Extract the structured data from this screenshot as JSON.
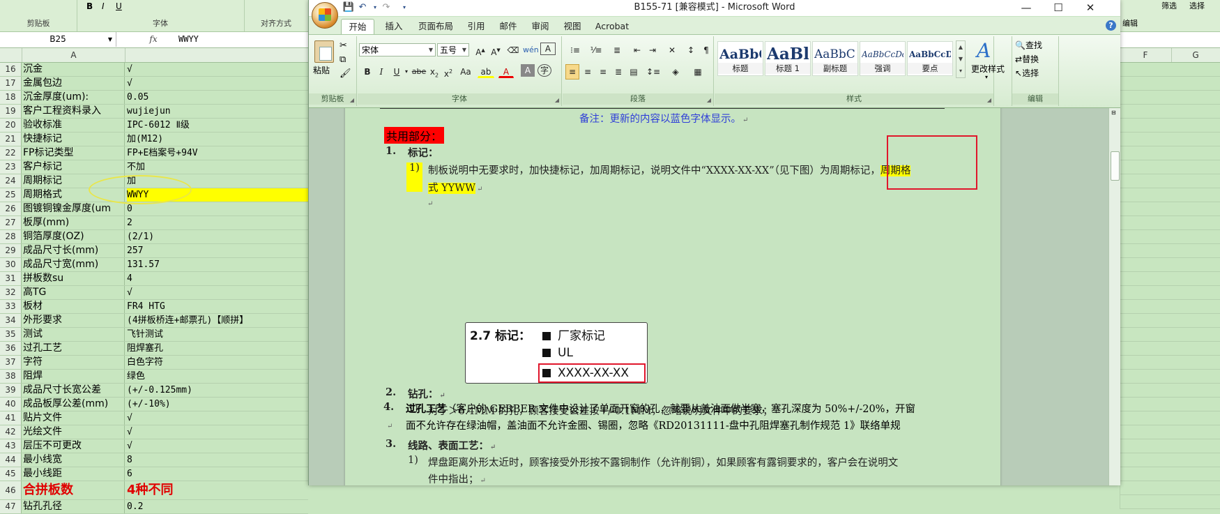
{
  "excel": {
    "ribbon_groups": [
      "剪贴板",
      "字体",
      "对齐方式",
      "编辑"
    ],
    "ribbon_right_buttons": [
      "筛选",
      "选择"
    ],
    "name_box": "B25",
    "fx": "fx",
    "formula_value": "WWYY",
    "columns": [
      "A",
      "F",
      "G"
    ],
    "rows": [
      {
        "n": "16",
        "a": "沉金",
        "b": "√"
      },
      {
        "n": "17",
        "a": "金属包边",
        "b": "√"
      },
      {
        "n": "18",
        "a": "沉金厚度(um):",
        "b": "0.05"
      },
      {
        "n": "19",
        "a": "客户工程资料录入",
        "b": "wujiejun"
      },
      {
        "n": "20",
        "a": "验收标准",
        "b": "IPC-6012 Ⅱ级"
      },
      {
        "n": "21",
        "a": "快捷标记",
        "b": "加(M12)"
      },
      {
        "n": "22",
        "a": "FP标记类型",
        "b": "FP+E档案号+94V"
      },
      {
        "n": "23",
        "a": "客户标记",
        "b": "不加"
      },
      {
        "n": "24",
        "a": "周期标记",
        "b": "加"
      },
      {
        "n": "25",
        "a": "周期格式",
        "b": "WWYY",
        "highlight": true
      },
      {
        "n": "26",
        "a": "图镀铜镍金厚度(um",
        "b": "0"
      },
      {
        "n": "27",
        "a": "板厚(mm)",
        "b": "2"
      },
      {
        "n": "28",
        "a": "铜箔厚度(OZ)",
        "b": "(2/1)"
      },
      {
        "n": "29",
        "a": "成品尺寸长(mm)",
        "b": "257"
      },
      {
        "n": "30",
        "a": "成品尺寸宽(mm)",
        "b": "131.57"
      },
      {
        "n": "31",
        "a": "拼板数su",
        "b": "4"
      },
      {
        "n": "32",
        "a": "高TG",
        "b": "√"
      },
      {
        "n": "33",
        "a": "板材",
        "b": "FR4 HTG"
      },
      {
        "n": "34",
        "a": "外形要求",
        "b": "(4拼板桥连+邮票孔)【顺拼】"
      },
      {
        "n": "35",
        "a": "测试",
        "b": "飞针测试"
      },
      {
        "n": "36",
        "a": "过孔工艺",
        "b": "阻焊塞孔"
      },
      {
        "n": "37",
        "a": "字符",
        "b": "白色字符"
      },
      {
        "n": "38",
        "a": "阻焊",
        "b": "绿色"
      },
      {
        "n": "39",
        "a": "成品尺寸长宽公差",
        "b": "(+/-0.125mm)"
      },
      {
        "n": "40",
        "a": "成品板厚公差(mm)",
        "b": "(+/-10%)"
      },
      {
        "n": "41",
        "a": "贴片文件",
        "b": "√"
      },
      {
        "n": "42",
        "a": "光绘文件",
        "b": "√"
      },
      {
        "n": "43",
        "a": "层压不可更改",
        "b": "√"
      },
      {
        "n": "44",
        "a": "最小线宽",
        "b": "8"
      },
      {
        "n": "45",
        "a": "最小线距",
        "b": "6"
      },
      {
        "n": "46",
        "a": "合拼板数",
        "b": "4种不同",
        "big": true
      },
      {
        "n": "47",
        "a": "钻孔孔径",
        "b": "0.2"
      }
    ]
  },
  "word": {
    "title": "B155-71 [兼容模式] - Microsoft Word",
    "tabs": [
      "开始",
      "插入",
      "页面布局",
      "引用",
      "邮件",
      "审阅",
      "视图",
      "Acrobat"
    ],
    "active_tab": "开始",
    "groups": {
      "clipboard": "剪贴板",
      "font": "字体",
      "paragraph": "段落",
      "styles": "样式",
      "editing": "编辑"
    },
    "paste_label": "粘贴",
    "font_name": "宋体",
    "font_size": "五号",
    "styles": [
      {
        "sample": "AaBbC(",
        "name": "标题"
      },
      {
        "sample": "AaBl",
        "name": "标题 1"
      },
      {
        "sample": "AaBbC(",
        "name": "副标题"
      },
      {
        "sample": "AaBbCcDd",
        "name": "强调"
      },
      {
        "sample": "AaBbCcD",
        "name": "要点"
      }
    ],
    "change_styles": "更改样式",
    "editing": {
      "find": "查找",
      "replace": "替换",
      "select": "选择"
    },
    "doc": {
      "note": "备注：更新的内容以蓝色字体显示。",
      "section": "共用部分：",
      "h1": {
        "num": "1.",
        "title": "标记："
      },
      "p1_num": "1)",
      "p1_line1": "制板说明中无要求时，加快捷标记，加周期标记，说明文件中“XXXX-XX-XX”（见下图）为周期标记，",
      "p1_hl1": "周期格",
      "p1_hl2": "式 YYWW",
      "figure": {
        "heading": "2.7 标记：",
        "items": [
          "厂家标记",
          "UL",
          "XXXX-XX-XX"
        ]
      },
      "h2": {
        "num": "2.",
        "title": "钻孔："
      },
      "p2_num": "1)",
      "p2": "对于＞6.4MM 的孔，顾客接受公差按+/-0.1MM，忽略说明文件中的要求；",
      "h3": {
        "num": "3.",
        "title": "线路、表面工艺："
      },
      "p3_num": "1)",
      "p3_line1": "焊盘距离外形太近时，顾客接受外形按不露铜制作（允许削铜），如果顾客有露铜要求的，客户会在说明文",
      "p3_line2": "件中指出；",
      "h4": {
        "num": "4.",
        "title": "过孔工艺"
      },
      "p4_line1": "（客户的 GERBER 文件中设计了单面开窗的孔，就要从盖油面做半塞，塞孔深度为 50%+/-20%，开窗",
      "p4_line2": "面不允许存在绿油帽，盖油面不允许金圈、锡圈，忽略《RD20131111-盘中孔阻焊塞孔制作规范 1》联络单规"
    }
  },
  "colors": {
    "excel_bg": "#c8e6c0",
    "highlight": "#ffff00",
    "annotation_red": "#e0162b",
    "note_blue": "#2f3fd8",
    "section_red": "#ff0000"
  }
}
